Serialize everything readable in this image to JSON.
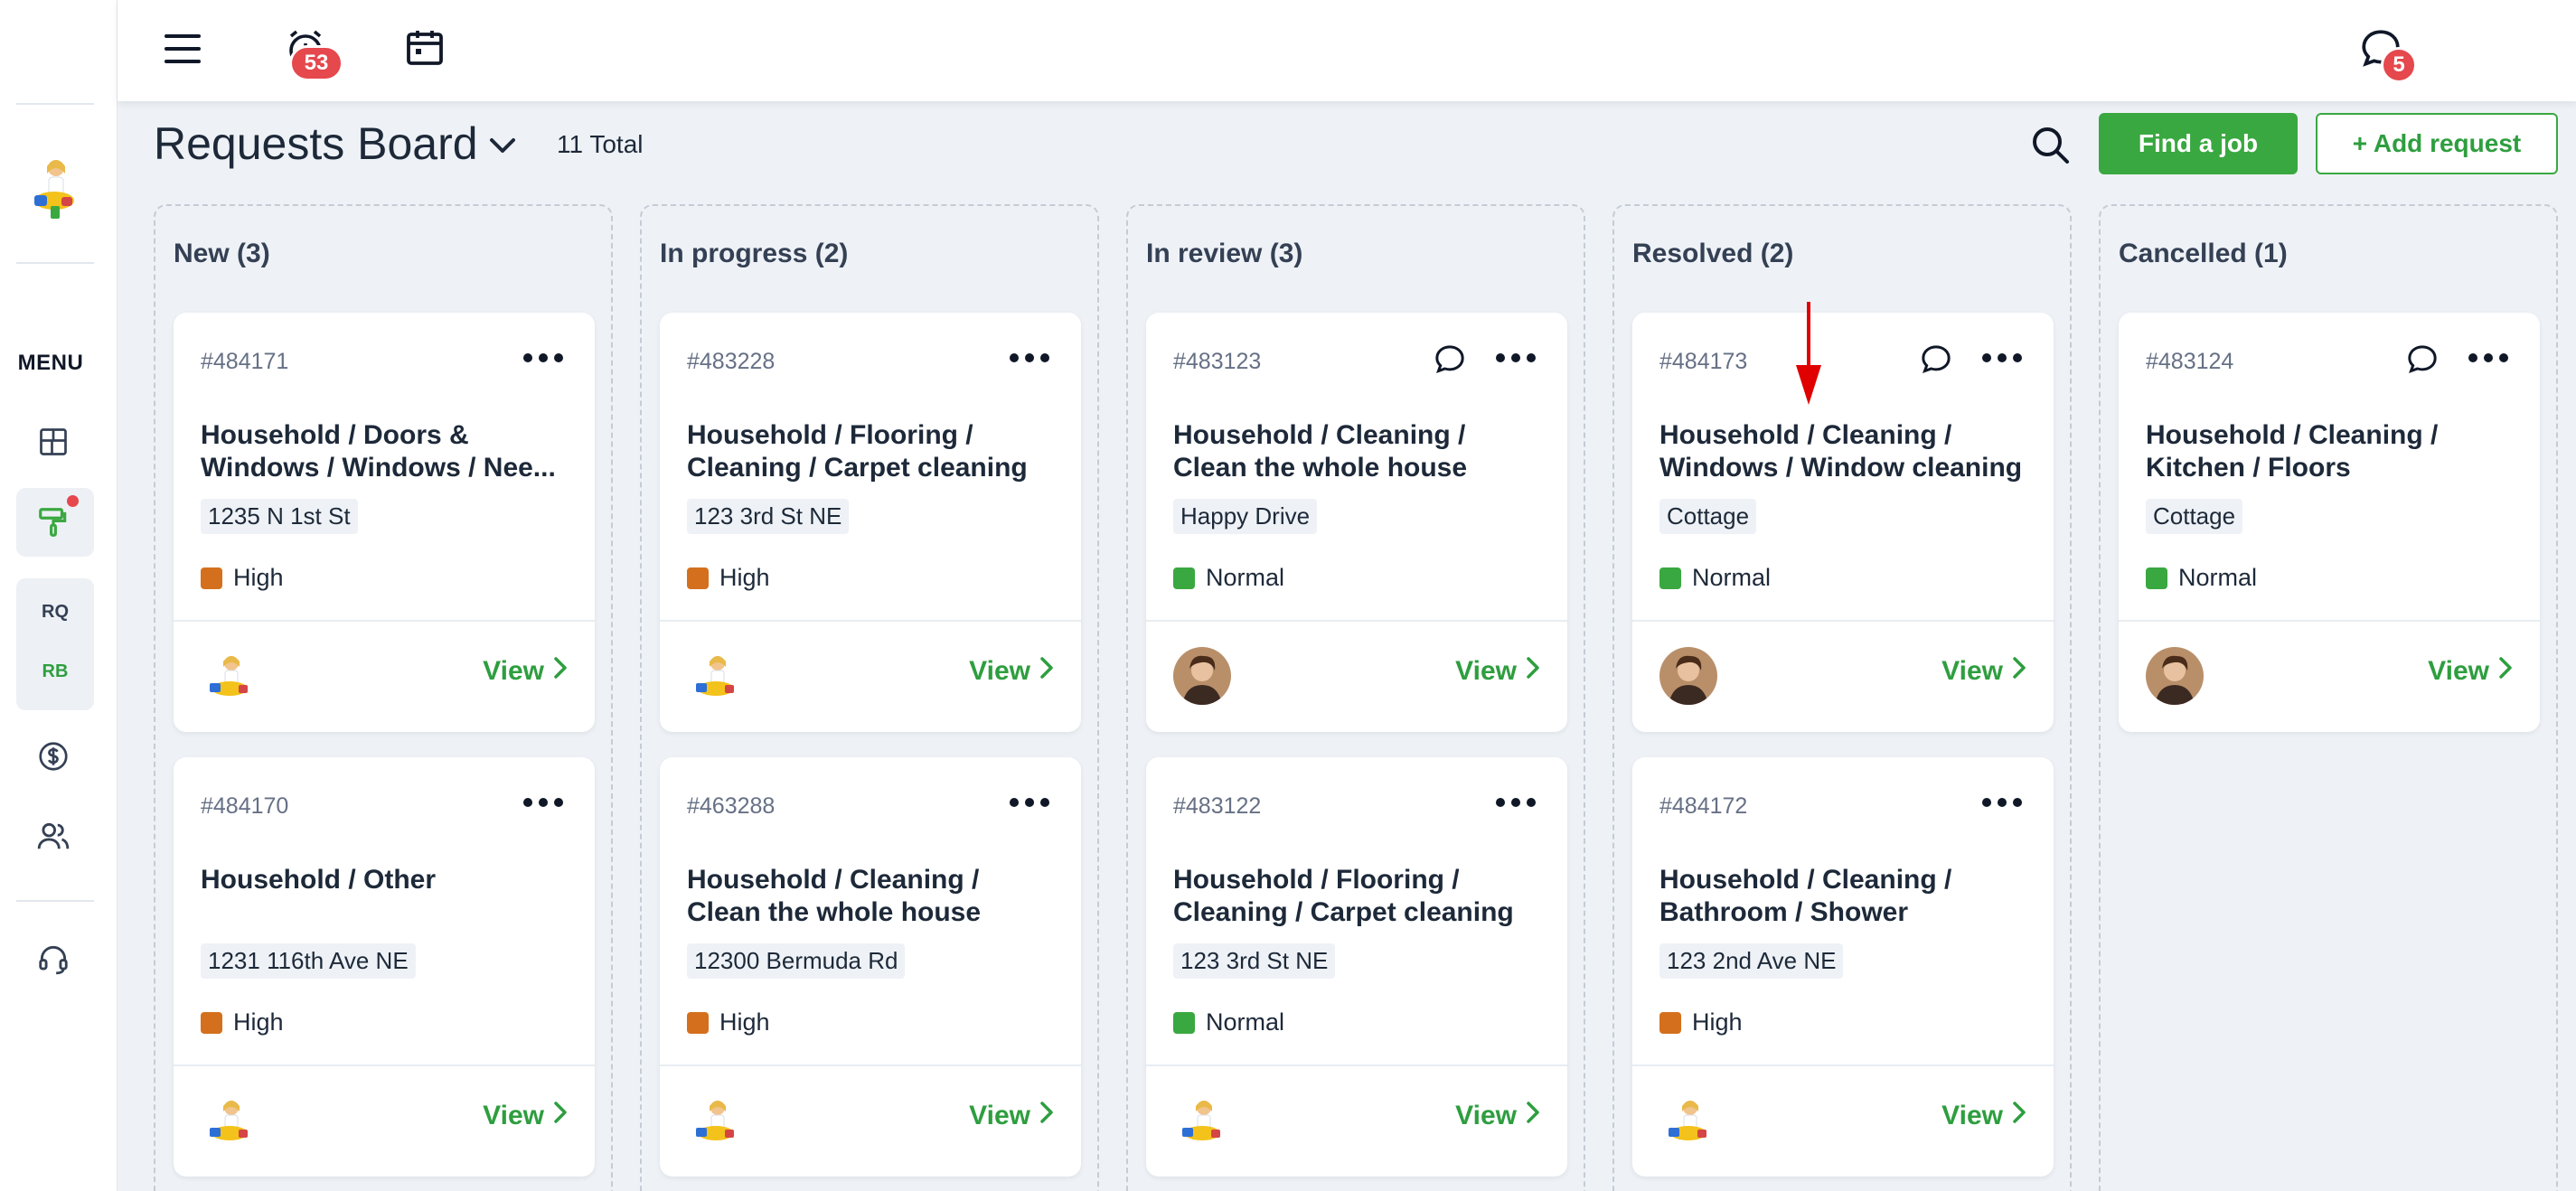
{
  "sidebar": {
    "menu_label": "MENU",
    "group_items": [
      "RQ",
      "RB"
    ]
  },
  "topbar": {
    "alarm_badge": "53",
    "chat_badge": "5"
  },
  "header": {
    "title": "Requests Board",
    "total": "11 Total",
    "find_job_label": "Find a job",
    "add_request_label": "+ Add request"
  },
  "colors": {
    "accent": "#3aa840",
    "high": "#d4701d",
    "normal": "#3aa840",
    "badge": "#e5484d"
  },
  "columns": [
    {
      "title": "New (3)",
      "cards": [
        {
          "id": "#484171",
          "chat": false,
          "title": "Household / Doors & Windows / Windows / Nee...",
          "address": "1235 N 1st St",
          "priority": "High",
          "assignee": "cleaner",
          "view": "View"
        },
        {
          "id": "#484170",
          "chat": false,
          "title": "Household / Other",
          "address": "1231 116th Ave NE",
          "priority": "High",
          "assignee": "cleaner",
          "view": "View"
        }
      ]
    },
    {
      "title": "In progress (2)",
      "cards": [
        {
          "id": "#483228",
          "chat": false,
          "title": "Household / Flooring / Cleaning / Carpet cleaning",
          "address": "123 3rd St NE",
          "priority": "High",
          "assignee": "cleaner",
          "view": "View"
        },
        {
          "id": "#463288",
          "chat": false,
          "title": "Household / Cleaning / Clean the whole house",
          "address": "12300 Bermuda Rd",
          "priority": "High",
          "assignee": "cleaner",
          "view": "View"
        }
      ]
    },
    {
      "title": "In review (3)",
      "cards": [
        {
          "id": "#483123",
          "chat": true,
          "title": "Household / Cleaning / Clean the whole house",
          "address": "Happy Drive",
          "priority": "Normal",
          "assignee": "man",
          "view": "View"
        },
        {
          "id": "#483122",
          "chat": false,
          "title": "Household / Flooring / Cleaning / Carpet cleaning",
          "address": "123 3rd St NE",
          "priority": "Normal",
          "assignee": "cleaner",
          "view": "View"
        }
      ]
    },
    {
      "title": "Resolved (2)",
      "cards": [
        {
          "id": "#484173",
          "chat": true,
          "title": "Household / Cleaning / Windows / Window cleaning",
          "address": "Cottage",
          "priority": "Normal",
          "assignee": "man",
          "view": "View"
        },
        {
          "id": "#484172",
          "chat": false,
          "title": "Household / Cleaning / Bathroom / Shower",
          "address": "123 2nd Ave NE",
          "priority": "High",
          "assignee": "cleaner",
          "view": "View"
        }
      ]
    },
    {
      "title": "Cancelled (1)",
      "cards": [
        {
          "id": "#483124",
          "chat": true,
          "title": "Household / Cleaning / Kitchen / Floors",
          "address": "Cottage",
          "priority": "Normal",
          "assignee": "man",
          "view": "View"
        }
      ]
    }
  ]
}
